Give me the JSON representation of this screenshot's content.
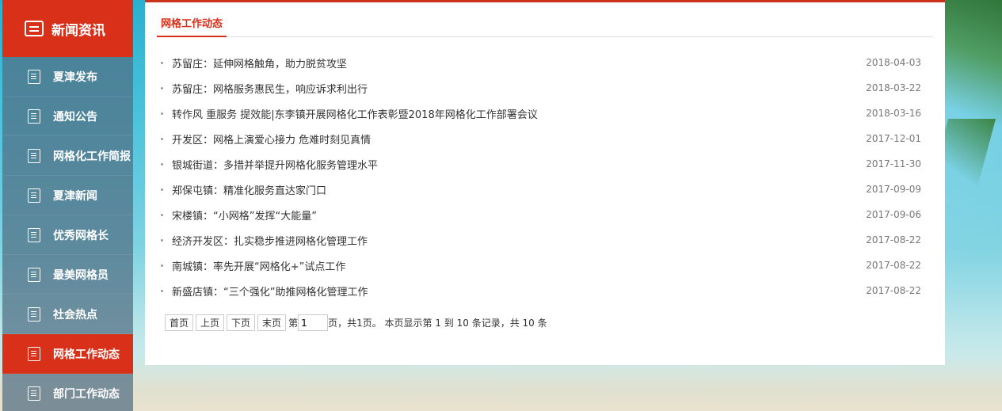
{
  "sidebar": {
    "header": "新闻资讯",
    "items": [
      {
        "label": "夏津发布",
        "active": false
      },
      {
        "label": "通知公告",
        "active": false
      },
      {
        "label": "网格化工作简报",
        "active": false
      },
      {
        "label": "夏津新闻",
        "active": false
      },
      {
        "label": "优秀网格长",
        "active": false
      },
      {
        "label": "最美网格员",
        "active": false
      },
      {
        "label": "社会热点",
        "active": false
      },
      {
        "label": "网格工作动态",
        "active": true
      },
      {
        "label": "部门工作动态",
        "active": false
      }
    ]
  },
  "main": {
    "title": "网格工作动态",
    "news": [
      {
        "title": "苏留庄：延伸网格触角，助力脱贫攻坚",
        "date": "2018-04-03"
      },
      {
        "title": "苏留庄：网格服务惠民生，响应诉求利出行",
        "date": "2018-03-22"
      },
      {
        "title": "转作风 重服务 提效能|东李镇开展网格化工作表彰暨2018年网格化工作部署会议",
        "date": "2018-03-16"
      },
      {
        "title": "开发区：网格上演爱心接力 危难时刻见真情",
        "date": "2017-12-01"
      },
      {
        "title": "银城街道：多措并举提升网格化服务管理水平",
        "date": "2017-11-30"
      },
      {
        "title": "郑保屯镇：精准化服务直达家门口",
        "date": "2017-09-09"
      },
      {
        "title": "宋楼镇：“小网格”发挥“大能量”",
        "date": "2017-09-06"
      },
      {
        "title": "经济开发区：扎实稳步推进网格化管理工作",
        "date": "2017-08-22"
      },
      {
        "title": "南城镇：率先开展“网格化+”试点工作",
        "date": "2017-08-22"
      },
      {
        "title": "新盛店镇：“三个强化”助推网格化管理工作",
        "date": "2017-08-22"
      }
    ]
  },
  "pager": {
    "first": "首页",
    "prev": "上页",
    "next": "下页",
    "last": "末页",
    "page_prefix": "第",
    "page_value": "1",
    "summary": "页，共1页。 本页显示第 1 到 10 条记录，共 10 条"
  },
  "colors": {
    "accent": "#d9301a",
    "sidebar_bg": "#506e82"
  }
}
